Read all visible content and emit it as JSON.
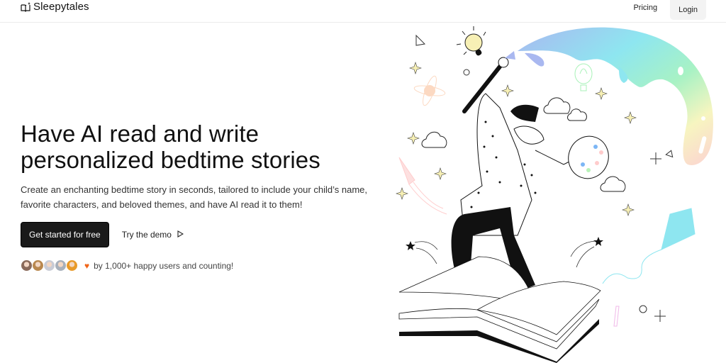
{
  "header": {
    "brand_icon": "open-book-sparkle-icon",
    "brand_name": "Sleepytales",
    "nav": {
      "pricing_label": "Pricing",
      "login_label": "Login"
    }
  },
  "hero": {
    "title_line1": "Have AI read and write",
    "title_line2": "personalized bedtime stories",
    "subtitle": "Create an enchanting bedtime story in seconds, tailored to include your child’s name, favorite characters, and beloved themes, and have AI read it to them!",
    "primary_cta": "Get started for free",
    "secondary_cta": "Try the demo",
    "secondary_cta_icon": "play-outline-icon",
    "social_proof": {
      "avatars": [
        {
          "name": "user-avatar-1",
          "color": "#8a6a5a"
        },
        {
          "name": "user-avatar-2",
          "color": "#b9884f"
        },
        {
          "name": "user-avatar-3",
          "color": "#c9ccd6"
        },
        {
          "name": "user-avatar-4",
          "color": "#a8b0bb"
        },
        {
          "name": "user-avatar-5",
          "color": "#e89a2a"
        }
      ],
      "heart_icon": "heart-icon",
      "heart_color": "#f06418",
      "text": "by 1,000+ happy users and counting!"
    }
  },
  "illustration": {
    "description": "Person painting a rainbow with a brush while standing on an open book, surrounded by clouds, stars, a kite, a rocket and a balloon"
  }
}
